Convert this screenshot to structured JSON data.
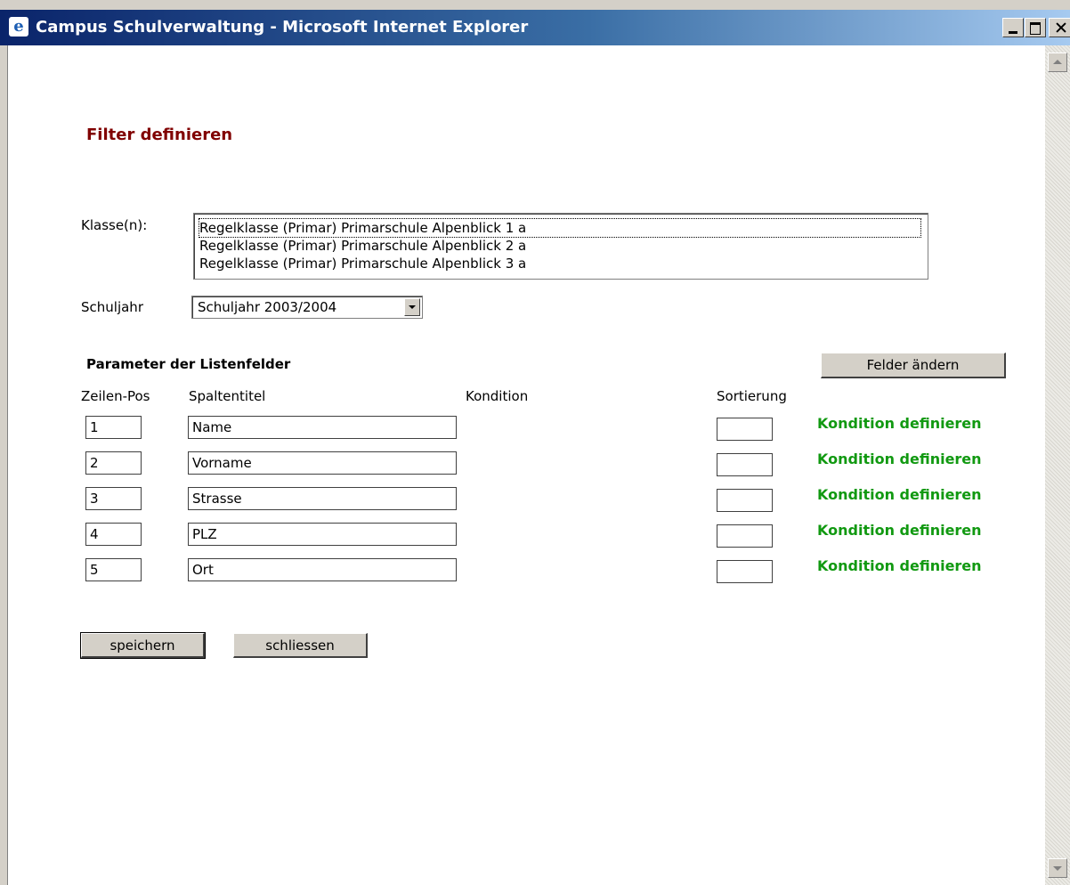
{
  "window": {
    "title": "Campus Schulverwaltung - Microsoft Internet Explorer"
  },
  "page": {
    "heading": "Filter definieren",
    "klasse_label": "Klasse(n):",
    "klassen": [
      "Regelklasse (Primar) Primarschule Alpenblick 1 a",
      "Regelklasse (Primar) Primarschule Alpenblick 2 a",
      "Regelklasse (Primar) Primarschule Alpenblick 3 a"
    ],
    "schuljahr_label": "Schuljahr",
    "schuljahr_value": "Schuljahr 2003/2004",
    "params_title": "Parameter der Listenfelder",
    "felder_button": "Felder ändern",
    "columns": {
      "pos": "Zeilen-Pos",
      "title": "Spaltentitel",
      "condition": "Kondition",
      "sort": "Sortierung"
    },
    "rows": [
      {
        "pos": "1",
        "title": "Name",
        "sort": "",
        "link": "Kondition definieren"
      },
      {
        "pos": "2",
        "title": "Vorname",
        "sort": "",
        "link": "Kondition definieren"
      },
      {
        "pos": "3",
        "title": "Strasse",
        "sort": "",
        "link": "Kondition definieren"
      },
      {
        "pos": "4",
        "title": "PLZ",
        "sort": "",
        "link": "Kondition definieren"
      },
      {
        "pos": "5",
        "title": "Ort",
        "sort": "",
        "link": "Kondition definieren"
      }
    ],
    "save_button": "speichern",
    "close_button": "schliessen"
  },
  "colors": {
    "heading": "#800000",
    "link": "#119911",
    "titlebar_start": "#0a246a"
  }
}
